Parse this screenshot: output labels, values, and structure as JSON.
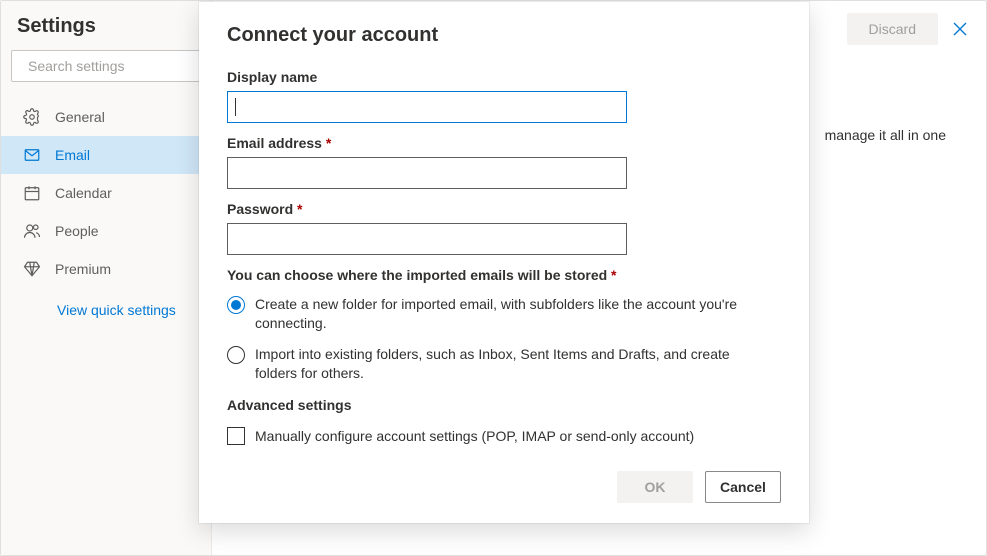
{
  "settings": {
    "title": "Settings",
    "search_placeholder": "Search settings",
    "nav": {
      "general": "General",
      "email": "Email",
      "calendar": "Calendar",
      "people": "People",
      "premium": "Premium"
    },
    "quick_link": "View quick settings"
  },
  "topbar": {
    "discard": "Discard"
  },
  "background_hint": "manage it all in one",
  "modal": {
    "title": "Connect your account",
    "display_name_label": "Display name",
    "display_name_value": "",
    "email_label": "Email address",
    "email_value": "",
    "password_label": "Password",
    "password_value": "",
    "required_mark": " *",
    "storage_label": "You can choose where the imported emails will be stored",
    "radio_new": "Create a new folder for imported email, with subfolders like the account you're connecting.",
    "radio_existing": "Import into existing folders, such as Inbox, Sent Items and Drafts, and create folders for others.",
    "advanced_label": "Advanced settings",
    "manual_config": "Manually configure account settings (POP, IMAP or send-only account)",
    "ok": "OK",
    "cancel": "Cancel"
  }
}
